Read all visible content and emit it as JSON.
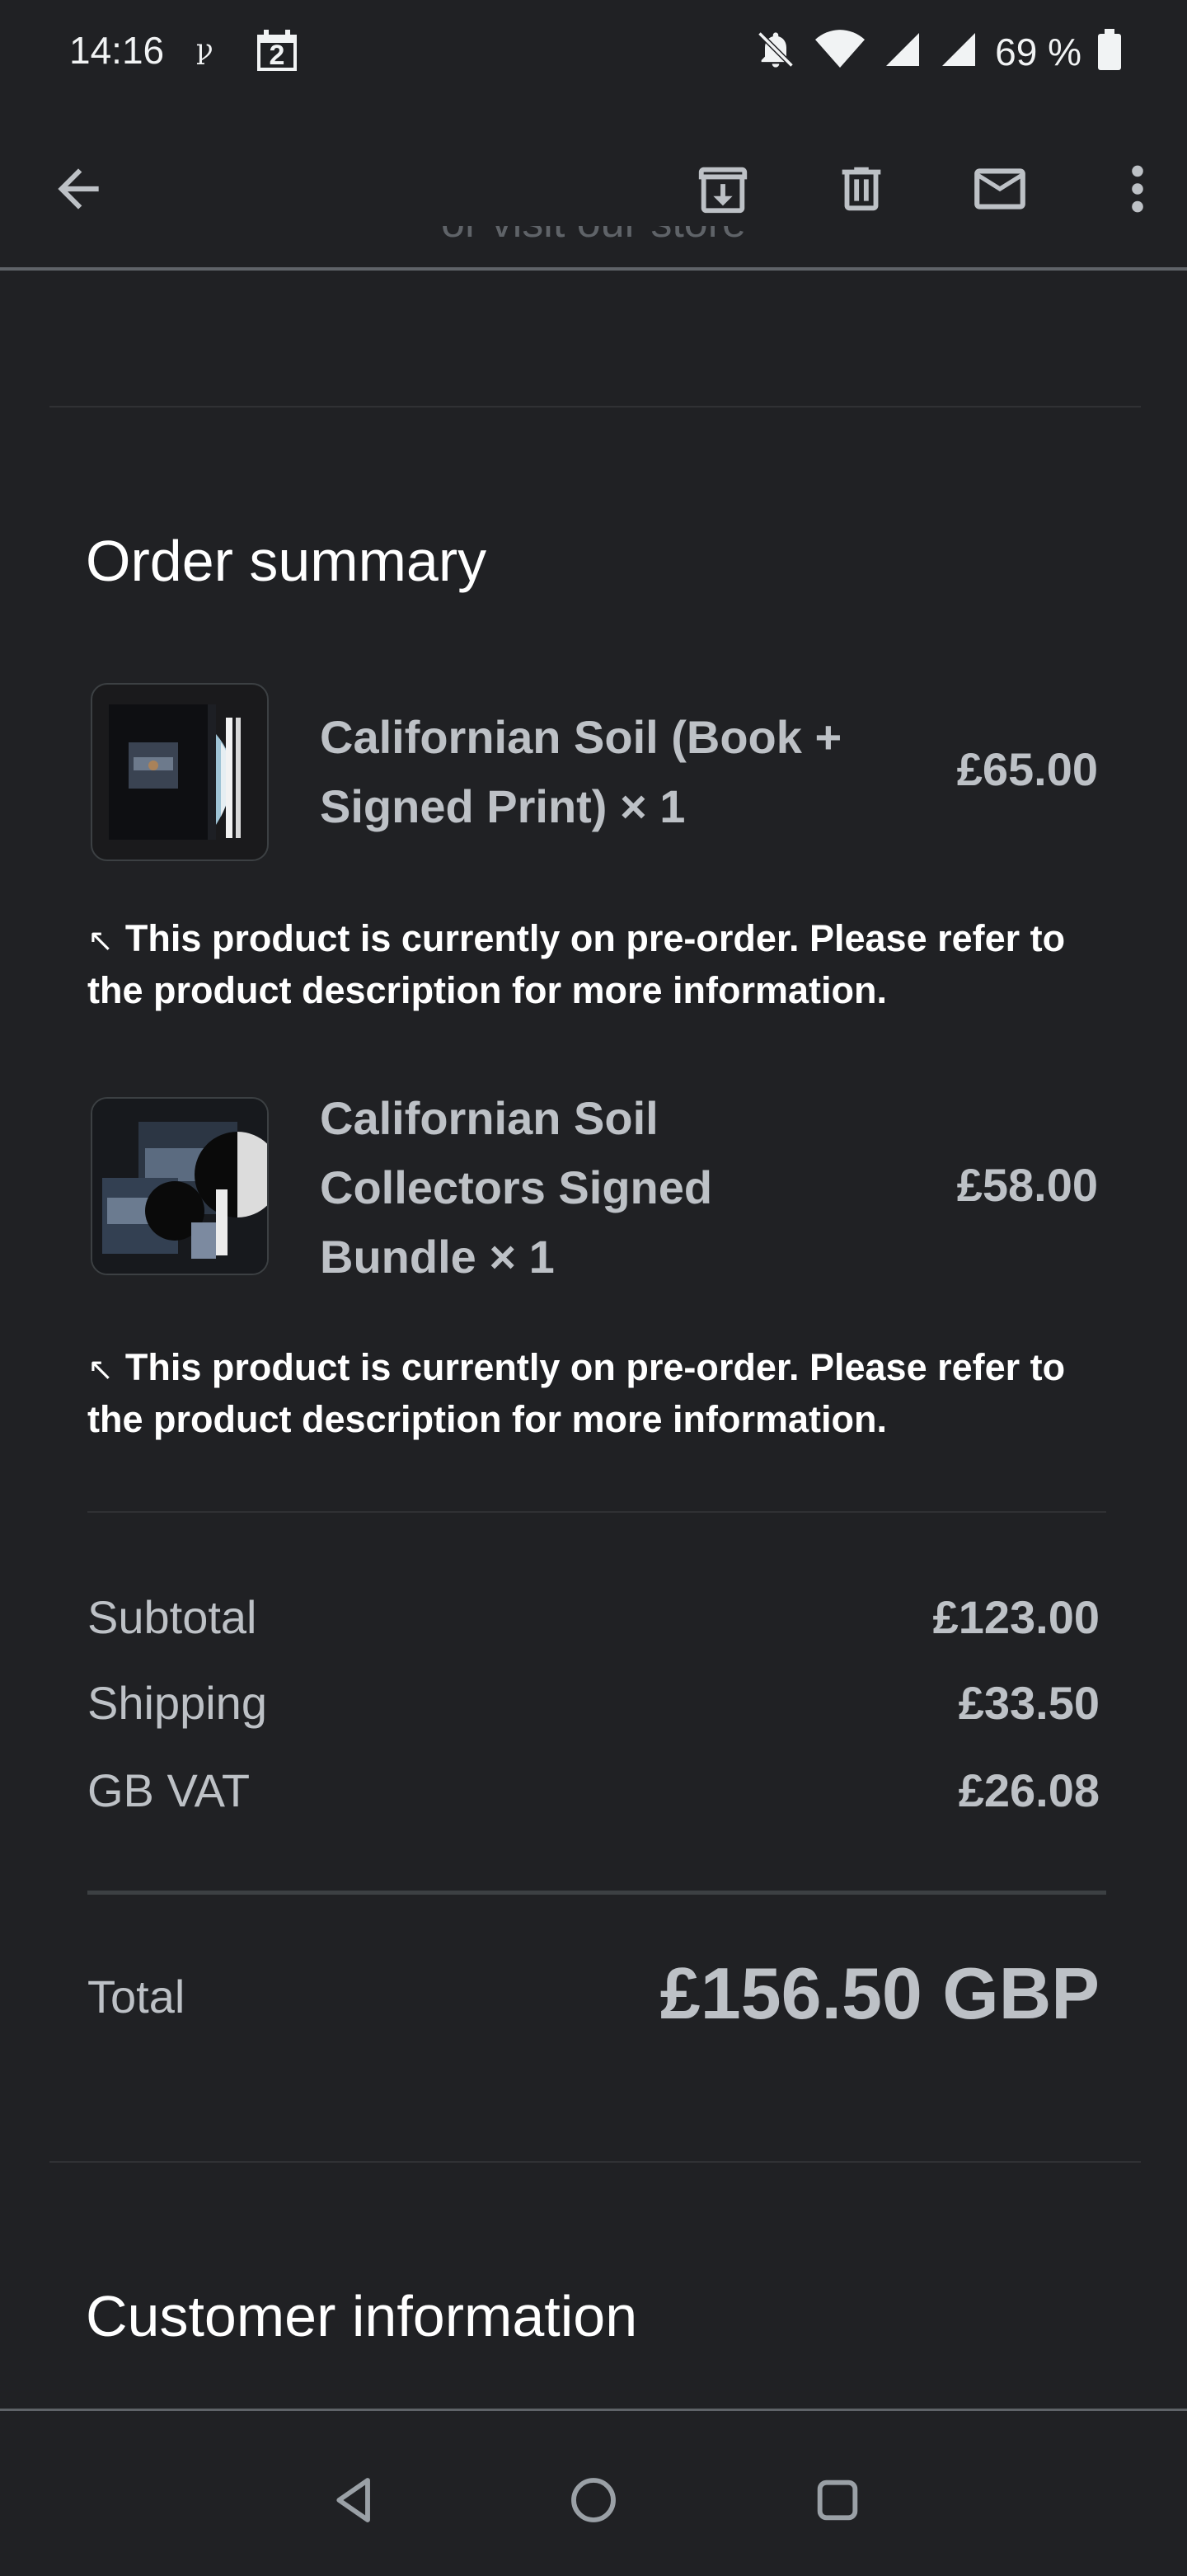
{
  "status_bar": {
    "time": "14:16",
    "calendar_day": "2",
    "battery_percent": "69 %"
  },
  "header": {
    "cut_off_text": "or visit our store"
  },
  "order_summary": {
    "title": "Order summary",
    "items": [
      {
        "name": "Californian Soil (Book + Signed Print) × 1",
        "price": "£65.00",
        "note": "This product is currently on pre-order. Please refer to the product description for more information."
      },
      {
        "name": "Californian Soil Collectors Signed Bundle × 1",
        "price": "£58.00",
        "note": "This product is currently on pre-order. Please refer to the product description for more information."
      }
    ],
    "note_icon": "↖",
    "subtotal_label": "Subtotal",
    "subtotal_value": "£123.00",
    "shipping_label": "Shipping",
    "shipping_value": "£33.50",
    "vat_label": "GB VAT",
    "vat_value": "£26.08",
    "total_label": "Total",
    "total_value": "£156.50 GBP"
  },
  "customer_information": {
    "title": "Customer information"
  },
  "colors": {
    "background": "#202124",
    "text_primary": "#ffffff",
    "text_secondary": "#bdc1c6",
    "divider": "#303134"
  }
}
